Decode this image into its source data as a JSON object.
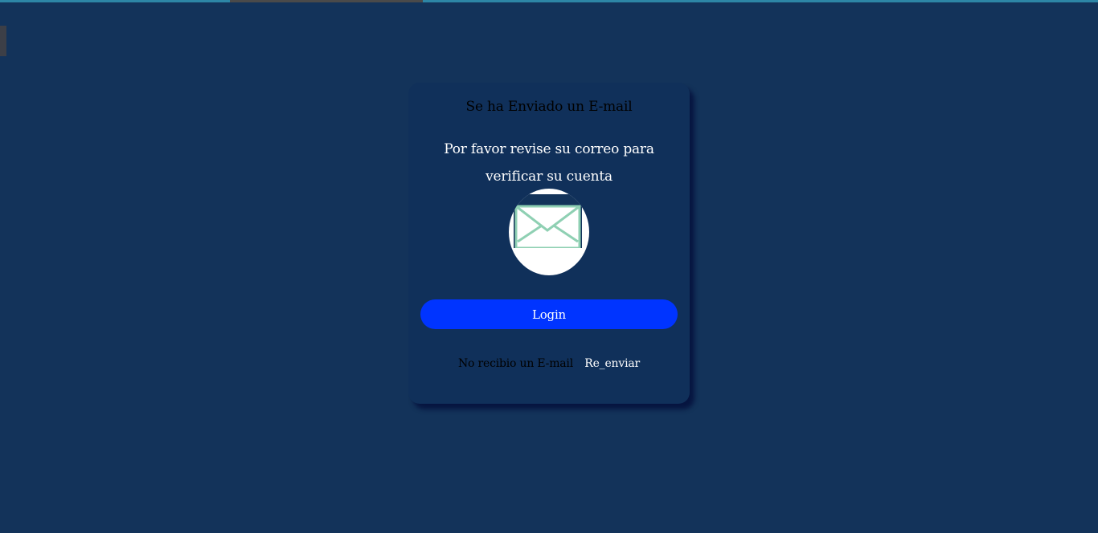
{
  "card": {
    "title": "Se ha Enviado un E-mail",
    "message": "Por favor revise su correo para verificar su cuenta",
    "icon": "envelope-icon",
    "login_label": "Login",
    "resend_prompt": "No recibio un E-mail",
    "resend_link": "Re_enviar"
  },
  "colors": {
    "background": "#13335a",
    "card": "#10305a",
    "button": "#0034ff",
    "envelope_stroke": "#8fd0b3"
  }
}
